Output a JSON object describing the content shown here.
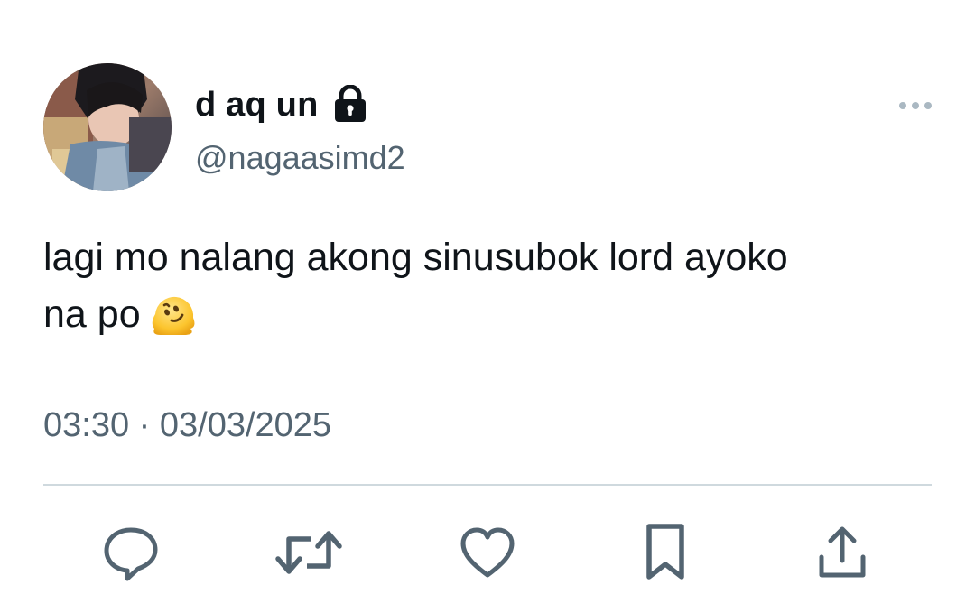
{
  "author": {
    "display_name": "d aq un",
    "handle": "@nagaasimd2",
    "protected": true,
    "avatar_icon": "avatar-photo"
  },
  "tweet": {
    "text_line1": "lagi mo nalang akong sinusubok lord ayoko",
    "text_line2": "na po",
    "emoji": "melting-face-emoji",
    "time": "03:30",
    "separator": "·",
    "date": "03/03/2025"
  },
  "actions": [
    {
      "name": "reply",
      "icon": "reply-icon"
    },
    {
      "name": "retweet",
      "icon": "retweet-icon"
    },
    {
      "name": "like",
      "icon": "heart-icon"
    },
    {
      "name": "bookmark",
      "icon": "bookmark-icon"
    },
    {
      "name": "share",
      "icon": "share-icon"
    }
  ],
  "colors": {
    "primary_text": "#0f1419",
    "secondary_text": "#536471",
    "divider": "#cfd9de",
    "more_dots": "#aab8c2"
  }
}
